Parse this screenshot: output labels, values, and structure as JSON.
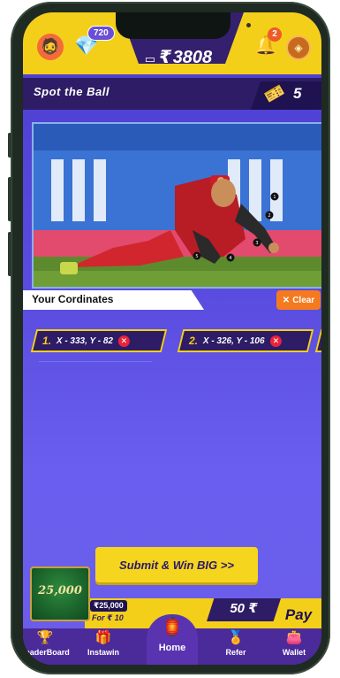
{
  "header": {
    "gems_count": "720",
    "wallet_currency": "₹",
    "wallet_amount": "3808",
    "notifications_count": "2",
    "icons": [
      "avatar",
      "diamond-icon",
      "wallet-icon",
      "bell-icon",
      "coin-icon"
    ]
  },
  "game": {
    "title": "Spot the Ball",
    "tickets": "5",
    "image_alt": "Cricket player diving to catch, with spotted dots 1-5",
    "markers": [
      "1",
      "2",
      "3",
      "4",
      "5"
    ]
  },
  "coordinates": {
    "label": "Your Cordinates",
    "clear_label": "Clear",
    "items": [
      {
        "num": "1.",
        "text": "X - 333, Y - 82"
      },
      {
        "num": "2.",
        "text": "X - 326, Y - 106"
      }
    ]
  },
  "actions": {
    "submit_label": "Submit & Win BIG >>",
    "jackpot_label": "25,000",
    "prize_amount": "₹25,000",
    "prize_for": "For ₹ 10",
    "amount": "50 ₹",
    "pay_label": "Pay"
  },
  "nav": {
    "items": [
      {
        "label": "LeaderBoard",
        "icon": "trophy-icon"
      },
      {
        "label": "Instawin",
        "icon": "gift-icon"
      },
      {
        "label": "Home",
        "icon": "home-icon"
      },
      {
        "label": "Refer",
        "icon": "medal-icon"
      },
      {
        "label": "Wallet",
        "icon": "wallet-icon"
      }
    ]
  },
  "colors": {
    "accent": "#f4cf1a",
    "primary": "#2e1c66",
    "danger": "#e8243a",
    "clear": "#f57a1f"
  }
}
